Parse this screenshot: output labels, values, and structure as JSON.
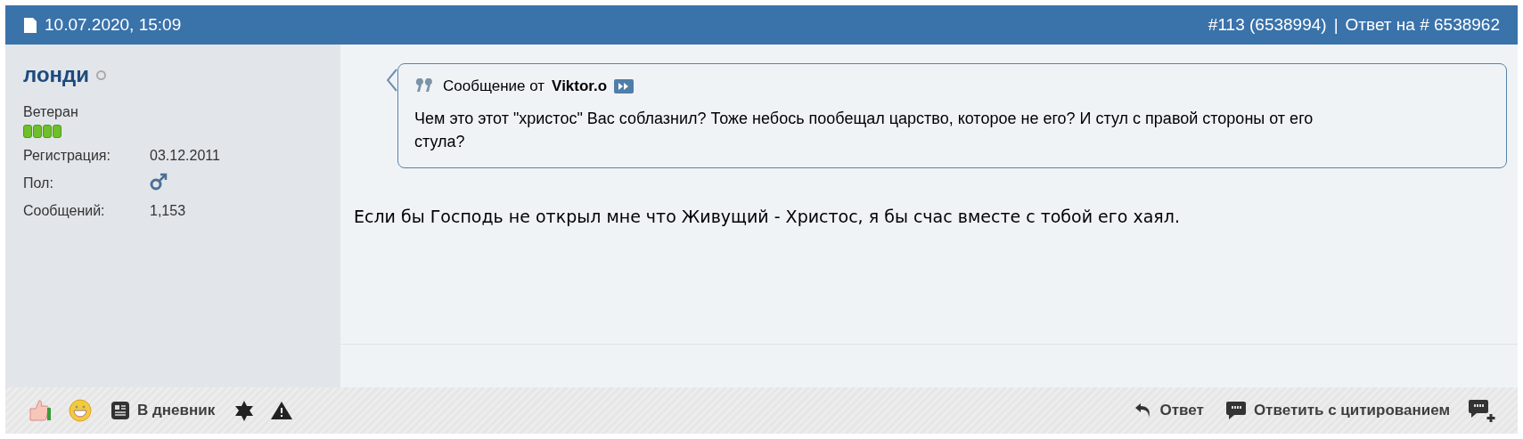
{
  "header": {
    "date": "10.07.2020, 15:09",
    "post_number": "#113 (6538994)",
    "separator": "|",
    "reply_to": "Ответ на # 6538962"
  },
  "user": {
    "name": "лонди",
    "online": false,
    "title": "Ветеран",
    "stars": 4,
    "fields": [
      {
        "label": "Регистрация:",
        "value": "03.12.2011",
        "kind": "text"
      },
      {
        "label": "Пол:",
        "kind": "gender"
      },
      {
        "label": "Сообщений:",
        "value": "1,153",
        "kind": "text"
      }
    ]
  },
  "quote": {
    "prefix": "Сообщение от",
    "author": "Viktor.o",
    "text": "Чем это этот \"христос\" Вас соблазнил? Тоже небось пообещал царство, которое не его? И стул с правой стороны от его стула?"
  },
  "message": "Если бы Господь не открыл мне что Живущий - Христос, я бы счас вместе с тобой его хаял.",
  "footer": {
    "left": [
      {
        "kind": "like"
      },
      {
        "kind": "smile"
      },
      {
        "kind": "diary",
        "label": "В дневник"
      },
      {
        "kind": "star"
      },
      {
        "kind": "report"
      }
    ],
    "right": [
      {
        "kind": "reply",
        "label": "Ответ"
      },
      {
        "kind": "quote",
        "label": "Ответить с цитированием"
      },
      {
        "kind": "multiquote"
      }
    ]
  }
}
